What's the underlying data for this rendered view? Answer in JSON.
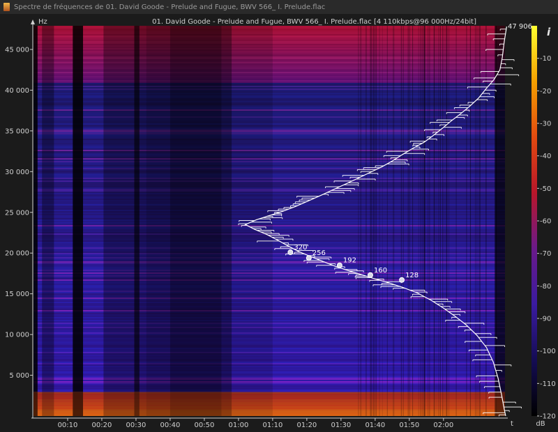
{
  "window": {
    "title": "Spectre de fréquences de 01. David Goode - Prelude and Fugue, BWV 566_ I. Prelude.flac"
  },
  "chart_data": {
    "type": "heatmap",
    "title": "01. David Goode - Prelude and Fugue, BWV 566_ I. Prelude.flac [4 110kbps@96 000Hz/24bit]",
    "xlabel": "t",
    "ylabel": "Hz",
    "ylim": [
      0,
      47906
    ],
    "ymax_label": "47 906",
    "xlim_seconds": [
      0,
      138
    ],
    "y_ticks": [
      {
        "value": 5000,
        "label": "5 000"
      },
      {
        "value": 10000,
        "label": "10 000"
      },
      {
        "value": 15000,
        "label": "15 000"
      },
      {
        "value": 20000,
        "label": "20 000"
      },
      {
        "value": 25000,
        "label": "25 000"
      },
      {
        "value": 30000,
        "label": "30 000"
      },
      {
        "value": 35000,
        "label": "35 000"
      },
      {
        "value": 40000,
        "label": "40 000"
      },
      {
        "value": 45000,
        "label": "45 000"
      }
    ],
    "x_ticks": [
      {
        "value": 10,
        "label": "00:10"
      },
      {
        "value": 20,
        "label": "00:20"
      },
      {
        "value": 30,
        "label": "00:30"
      },
      {
        "value": 40,
        "label": "00:40"
      },
      {
        "value": 50,
        "label": "00:50"
      },
      {
        "value": 60,
        "label": "01:00"
      },
      {
        "value": 70,
        "label": "01:10"
      },
      {
        "value": 80,
        "label": "01:20"
      },
      {
        "value": 90,
        "label": "01:30"
      },
      {
        "value": 100,
        "label": "01:40"
      },
      {
        "value": 110,
        "label": "01:50"
      },
      {
        "value": 120,
        "label": "02:00"
      }
    ],
    "colorbar": {
      "label": "dB",
      "range": [
        -120,
        0
      ],
      "ticks": [
        {
          "value": -10,
          "label": "-10"
        },
        {
          "value": -20,
          "label": "-20"
        },
        {
          "value": -30,
          "label": "-30"
        },
        {
          "value": -40,
          "label": "-40"
        },
        {
          "value": -50,
          "label": "-50"
        },
        {
          "value": -60,
          "label": "-60"
        },
        {
          "value": -70,
          "label": "-70"
        },
        {
          "value": -80,
          "label": "-80"
        },
        {
          "value": -90,
          "label": "-90"
        },
        {
          "value": -100,
          "label": "-100"
        },
        {
          "value": -110,
          "label": "-110"
        },
        {
          "value": -120,
          "label": "-120"
        }
      ],
      "info_label": "i",
      "colors": [
        "#000000",
        "#140c54",
        "#3a1ba0",
        "#6a1a8a",
        "#b8162a",
        "#e24a10",
        "#f5a000",
        "#ffff30"
      ]
    },
    "annotations": [
      {
        "label": "320",
        "x": 75.2,
        "y": 20100
      },
      {
        "label": "256",
        "x": 80.6,
        "y": 19400
      },
      {
        "label": "192",
        "x": 89.6,
        "y": 18500
      },
      {
        "label": "160",
        "x": 98.6,
        "y": 17300
      },
      {
        "label": "128",
        "x": 107.8,
        "y": 16700
      }
    ],
    "band_ranges": {
      "low_loud_max_hz": 3000,
      "high_loud_min_hz": 41000
    },
    "bitrate_curve": [
      [
        138.5,
        47800
      ],
      [
        137.8,
        46000
      ],
      [
        137.2,
        44000
      ],
      [
        136.5,
        42500
      ],
      [
        134.8,
        41300
      ],
      [
        132.5,
        40200
      ],
      [
        130.2,
        39000
      ],
      [
        127.6,
        38000
      ],
      [
        125.0,
        37100
      ],
      [
        122.2,
        36200
      ],
      [
        119.6,
        35300
      ],
      [
        116.9,
        34400
      ],
      [
        114.3,
        33600
      ],
      [
        111.2,
        32900
      ],
      [
        108.0,
        32100
      ],
      [
        105.0,
        31300
      ],
      [
        102.0,
        30600
      ],
      [
        98.5,
        29900
      ],
      [
        95.0,
        29200
      ],
      [
        91.5,
        28500
      ],
      [
        87.8,
        27800
      ],
      [
        84.2,
        27100
      ],
      [
        80.4,
        26400
      ],
      [
        76.6,
        25700
      ],
      [
        72.8,
        25100
      ],
      [
        69.0,
        24600
      ],
      [
        65.3,
        24100
      ],
      [
        62.0,
        23500
      ],
      [
        64.8,
        22900
      ],
      [
        68.2,
        22300
      ],
      [
        71.4,
        21600
      ],
      [
        74.4,
        20900
      ],
      [
        77.6,
        20200
      ],
      [
        81.0,
        19600
      ],
      [
        84.6,
        19000
      ],
      [
        88.2,
        18400
      ],
      [
        91.8,
        17900
      ],
      [
        95.6,
        17400
      ],
      [
        99.4,
        16900
      ],
      [
        103.6,
        16400
      ],
      [
        108.0,
        15800
      ],
      [
        112.4,
        15100
      ],
      [
        116.4,
        14200
      ],
      [
        119.8,
        13300
      ],
      [
        123.2,
        12300
      ],
      [
        126.6,
        11200
      ],
      [
        129.8,
        9900
      ],
      [
        132.6,
        8400
      ],
      [
        134.6,
        6600
      ],
      [
        136.0,
        4600
      ],
      [
        137.0,
        2600
      ],
      [
        137.8,
        800
      ],
      [
        138.2,
        0
      ]
    ]
  }
}
